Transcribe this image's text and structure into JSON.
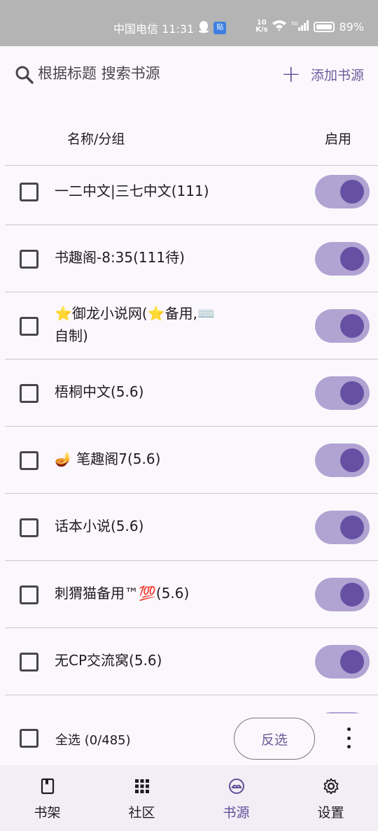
{
  "status_bar": {
    "carrier_time": "中国电信 11:31",
    "app_badge": "贴",
    "net_speed_top": "10",
    "net_speed_bottom": "K/s",
    "signal_label": "5G",
    "battery": "89%"
  },
  "search": {
    "placeholder": "根据标题 搜索书源",
    "add_label": "添加书源"
  },
  "columns": {
    "name": "名称/分组",
    "enabled": "启用"
  },
  "sources": [
    {
      "label": "一二中文|三七中文(111)",
      "enabled": true,
      "checked": false
    },
    {
      "label": "书趣阁-8:35(111待)",
      "enabled": true,
      "checked": false
    },
    {
      "label": "⭐御龙小说网(⭐备用,⌨️自制)",
      "enabled": true,
      "checked": false
    },
    {
      "label": "梧桐中文(5.6)",
      "enabled": true,
      "checked": false
    },
    {
      "label": "🪔 笔趣阁7(5.6)",
      "enabled": true,
      "checked": false
    },
    {
      "label": "话本小说(5.6)",
      "enabled": true,
      "checked": false
    },
    {
      "label": "刺猬猫备用™💯(5.6)",
      "enabled": true,
      "checked": false
    },
    {
      "label": "无CP交流窝(5.6)",
      "enabled": true,
      "checked": false
    }
  ],
  "select_bar": {
    "select_all_label": "全选 (0/485)",
    "invert_label": "反选"
  },
  "nav": [
    {
      "label": "书架",
      "icon": "bookshelf-icon",
      "active": false
    },
    {
      "label": "社区",
      "icon": "community-grid-icon",
      "active": false
    },
    {
      "label": "书源",
      "icon": "book-source-icon",
      "active": true
    },
    {
      "label": "设置",
      "icon": "settings-gear-icon",
      "active": false
    }
  ],
  "colors": {
    "accent": "#6750a4",
    "toggle_track": "#b1a3d2",
    "status_bar": "#b4b4b4"
  }
}
